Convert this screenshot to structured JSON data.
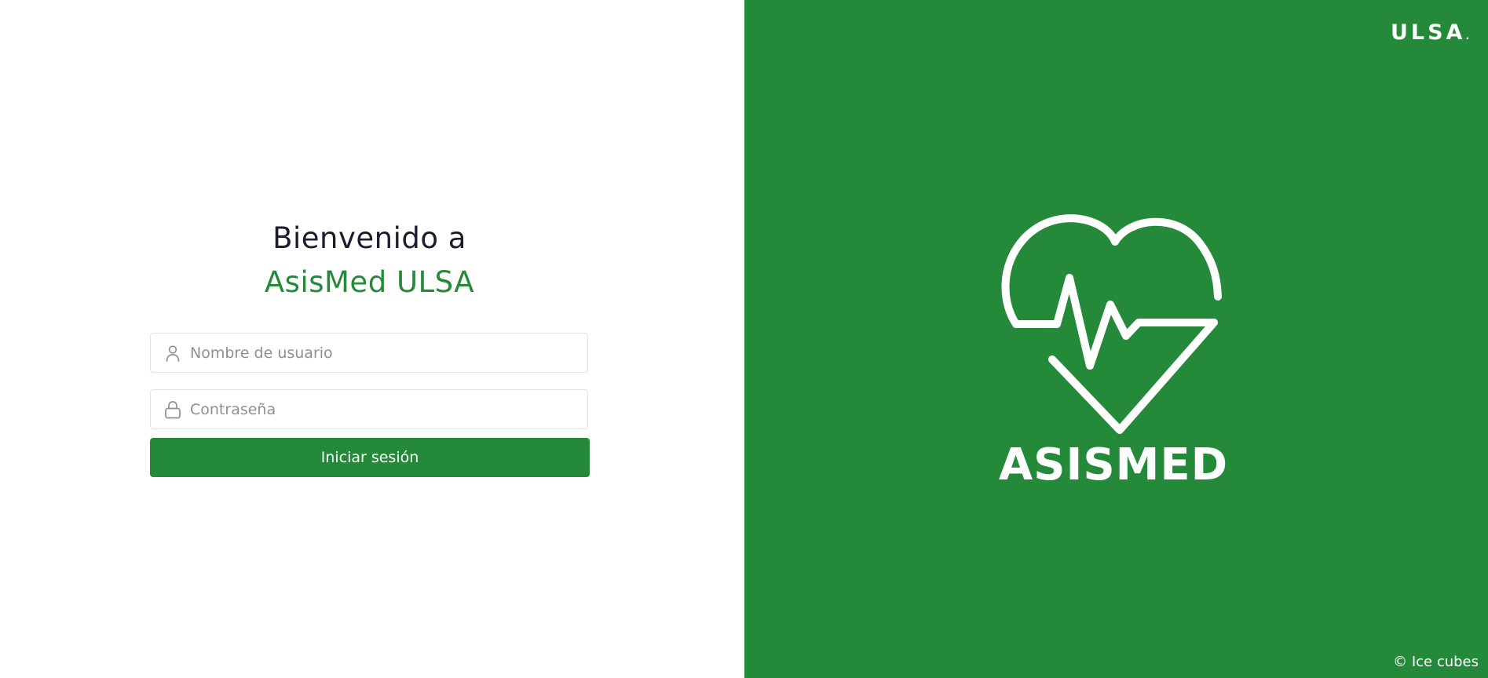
{
  "welcome": {
    "line1": "Bienvenido a",
    "line2": "AsisMed ULSA"
  },
  "form": {
    "username_placeholder": "Nombre de usuario",
    "password_placeholder": "Contraseña",
    "username_icon": "user-icon",
    "password_icon": "lock-icon",
    "submit_label": "Iniciar sesión"
  },
  "brand": {
    "top_label": "ULSA",
    "top_label_dot": ".",
    "logo_icon": "heart-pulse-icon",
    "logo_word": "ASISMED",
    "copyright": "© Ice cubes"
  },
  "colors": {
    "accent": "#248a3a",
    "title_dark": "#1b1d2e",
    "placeholder": "#8e8e99",
    "input_border": "#e3e3e6"
  }
}
